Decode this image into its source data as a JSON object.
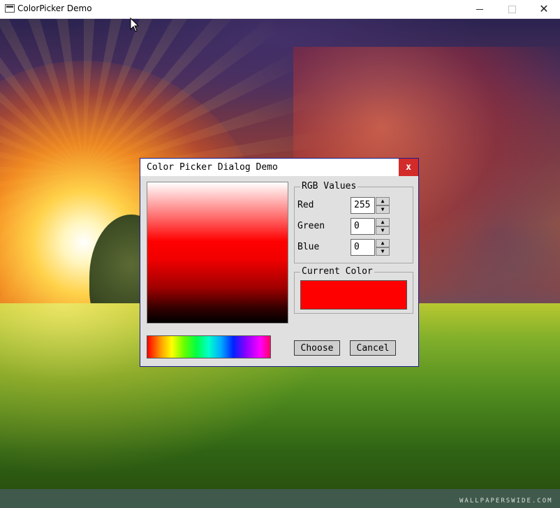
{
  "window": {
    "title": "ColorPicker Demo",
    "minimize_glyph": "",
    "close_glyph": "✕"
  },
  "background": {
    "description_icon": "wallpaper-image",
    "watermark": "WALLPAPERSWIDE.COM"
  },
  "dialog": {
    "title": "Color Picker Dialog Demo",
    "close_glyph": "x",
    "rgb_group": {
      "legend": "RGB Values",
      "fields": [
        {
          "label": "Red",
          "value": "255"
        },
        {
          "label": "Green",
          "value": "0"
        },
        {
          "label": "Blue",
          "value": "0"
        }
      ]
    },
    "current_color_group": {
      "legend": "Current Color",
      "color": "#ff0000"
    },
    "buttons": {
      "choose": "Choose",
      "cancel": "Cancel"
    },
    "selected_hue_color": "#ff0000"
  },
  "colors": {
    "dialog_border": "#1c1c8c",
    "close_button": "#d32a2a",
    "dialog_bg": "#e0e0e0"
  }
}
